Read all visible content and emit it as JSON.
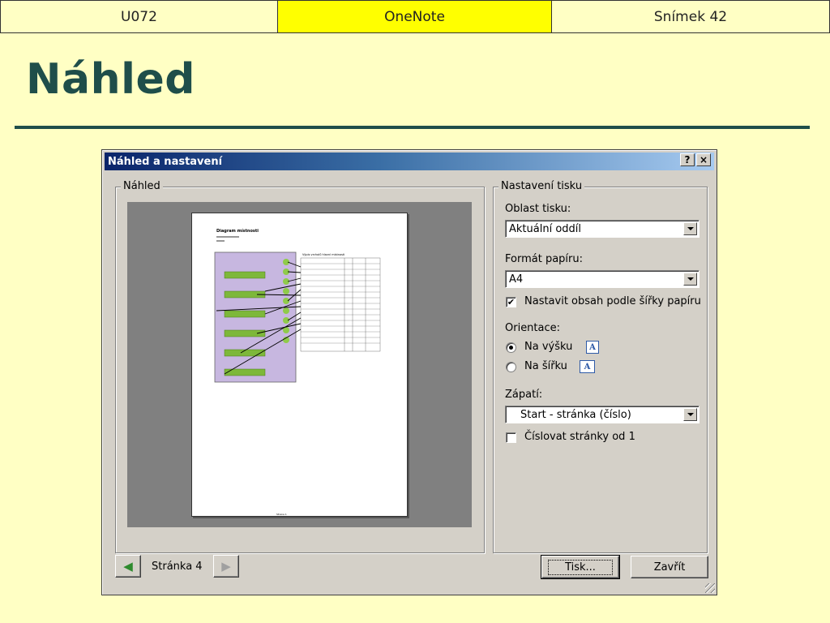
{
  "header": {
    "left": "U072",
    "center": "OneNote",
    "right": "Snímek 42",
    "center_color": "#FFFF00"
  },
  "slide": {
    "title": "Náhled",
    "title_color": "#1F4E4A",
    "background": "#FFFFC4"
  },
  "dialog": {
    "title": "Náhled a nastavení",
    "help_label": "?",
    "close_label": "×",
    "preview": {
      "group_label": "Náhled",
      "doc_title": "Diagram místnosti",
      "doc_subtitle": "Výpis vrcholů hlavní místnosti",
      "doc_footer": "Strana 1"
    },
    "settings": {
      "group_label": "Nastavení tisku",
      "print_area": {
        "label": "Oblast tisku:",
        "value": "Aktuální oddíl"
      },
      "paper_format": {
        "label": "Formát papíru:",
        "value": "A4"
      },
      "fit_width": {
        "label": "Nastavit obsah podle šířky papíru",
        "checked": true
      },
      "orientation": {
        "label": "Orientace:",
        "portrait": "Na výšku",
        "landscape": "Na šířku",
        "selected": "portrait"
      },
      "footer": {
        "label": "Zápatí:",
        "value": "Start - stránka (číslo)"
      },
      "number_pages": {
        "label": "Číslovat stránky od 1",
        "checked": false
      }
    },
    "nav": {
      "page_label": "Stránka 4"
    },
    "buttons": {
      "print": "Tisk...",
      "close": "Zavřít"
    }
  }
}
